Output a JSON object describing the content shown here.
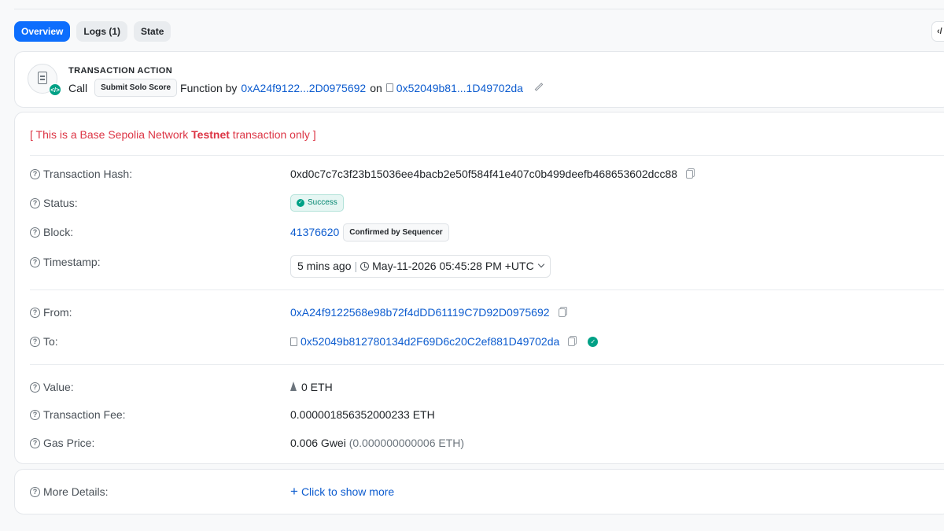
{
  "tabs": [
    {
      "label": "Overview",
      "active": true
    },
    {
      "label": "Logs (1)",
      "active": false
    },
    {
      "label": "State",
      "active": false
    }
  ],
  "code_toggle_label": "‹/",
  "action": {
    "title": "TRANSACTION ACTION",
    "call": "Call",
    "method": "Submit Solo Score",
    "function_by": "Function by",
    "from_short": "0xA24f9122...2D0975692",
    "on": "on",
    "to_short": "0x52049b81...1D49702da"
  },
  "notice": {
    "prefix": "[ This is a Base Sepolia Network ",
    "bold": "Testnet",
    "suffix": " transaction only ]"
  },
  "details": {
    "hash_label": "Transaction Hash:",
    "hash": "0xd0c7c7c3f23b15036ee4bacb2e50f584f41e407c0b499deefb468653602dcc88",
    "status_label": "Status:",
    "status": "Success",
    "block_label": "Block:",
    "block": "41376620",
    "block_badge": "Confirmed by Sequencer",
    "timestamp_label": "Timestamp:",
    "timestamp_relative": "5 mins ago",
    "timestamp_sep": "|",
    "timestamp_abs": "May-11-2026 05:45:28 PM +UTC",
    "from_label": "From:",
    "from": "0xA24f9122568e98b72f4dDD61119C7D92D0975692",
    "to_label": "To:",
    "to": "0x52049b812780134d2F69D6c20C2ef881D49702da",
    "value_label": "Value:",
    "value": "0 ETH",
    "fee_label": "Transaction Fee:",
    "fee": "0.000001856352000233 ETH",
    "gas_label": "Gas Price:",
    "gas": "0.006 Gwei",
    "gas_eth": "(0.000000000006 ETH)"
  },
  "more": {
    "label": "More Details:",
    "link": "Click to show more"
  }
}
